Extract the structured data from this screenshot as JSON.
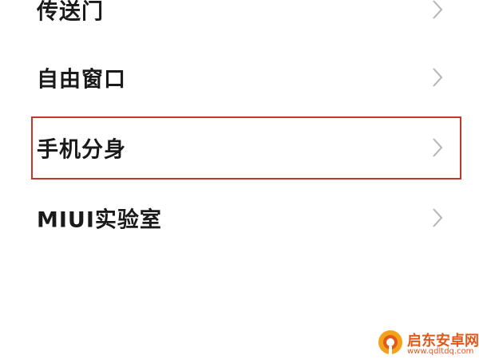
{
  "menu": {
    "items": [
      {
        "label": "传送门",
        "icon": "chevron-right-icon"
      },
      {
        "label": "自由窗口",
        "icon": "chevron-right-icon"
      },
      {
        "label": "手机分身",
        "icon": "chevron-right-icon",
        "highlighted": true
      },
      {
        "label": "MIUI实验室",
        "icon": "chevron-right-icon"
      }
    ]
  },
  "colors": {
    "highlight_border": "#c0392b",
    "text": "#1a1a1a",
    "chevron": "#b3b3b3",
    "watermark": "#e05a1c"
  },
  "watermark": {
    "name": "启东安卓网",
    "url": "www.qdltdq.com",
    "icon": "logo-icon"
  }
}
